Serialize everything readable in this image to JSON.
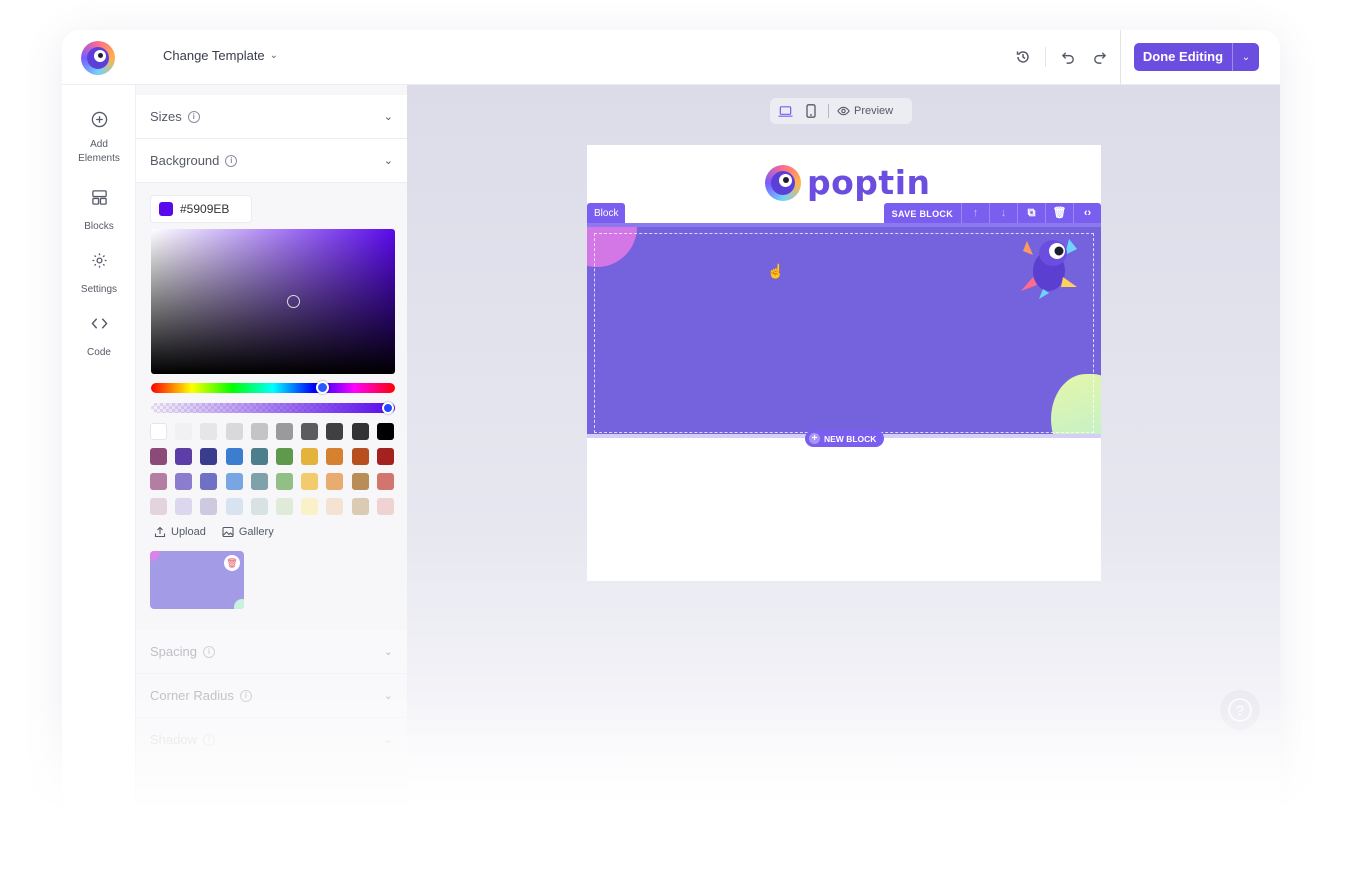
{
  "topbar": {
    "change_template_label": "Change Template",
    "done_label": "Done Editing"
  },
  "rail": {
    "items": [
      {
        "label": "Add Elements",
        "icon": "plus-circle-icon"
      },
      {
        "label": "Blocks",
        "icon": "blocks-icon"
      },
      {
        "label": "Settings",
        "icon": "gear-icon"
      },
      {
        "label": "Code",
        "icon": "code-icon"
      }
    ]
  },
  "panel": {
    "sections": {
      "sizes": "Sizes",
      "background": "Background",
      "spacing": "Spacing",
      "corner_radius": "Corner Radius",
      "shadow": "Shadow"
    },
    "background": {
      "hex_value": "#5909EB",
      "upload_label": "Upload",
      "gallery_label": "Gallery"
    },
    "swatch_colors": [
      "#ffffff",
      "#f1f1f1",
      "#e6e6e6",
      "#d9d9d9",
      "#c4c4c4",
      "#9a9a9a",
      "#5c5c5c",
      "#404040",
      "#333333",
      "#000000",
      "#8b4a78",
      "#5d3ea7",
      "#3a3d8c",
      "#3c7dd0",
      "#4c7e8c",
      "#5f9a4c",
      "#e3b33b",
      "#d5812f",
      "#b84f1f",
      "#a3221f",
      "#b47ea3",
      "#8c7cce",
      "#6f72c4",
      "#79a6e3",
      "#7fa2aa",
      "#92bf85",
      "#f2cc6c",
      "#e8ab70",
      "#b88e58",
      "#d2756e",
      "#e2d3dc",
      "#dcd7ef",
      "#cfc9e0",
      "#d8e3f1",
      "#d8e2e3",
      "#dfead9",
      "#fbf1c9",
      "#f4e3d3",
      "#dccbb4",
      "#efd2d2"
    ]
  },
  "canvas": {
    "preview_label": "Preview",
    "brand_text": "poptin",
    "block_tag": "Block",
    "save_block_label": "SAVE BLOCK",
    "new_block_label": "NEW BLOCK",
    "help_label": "?"
  }
}
